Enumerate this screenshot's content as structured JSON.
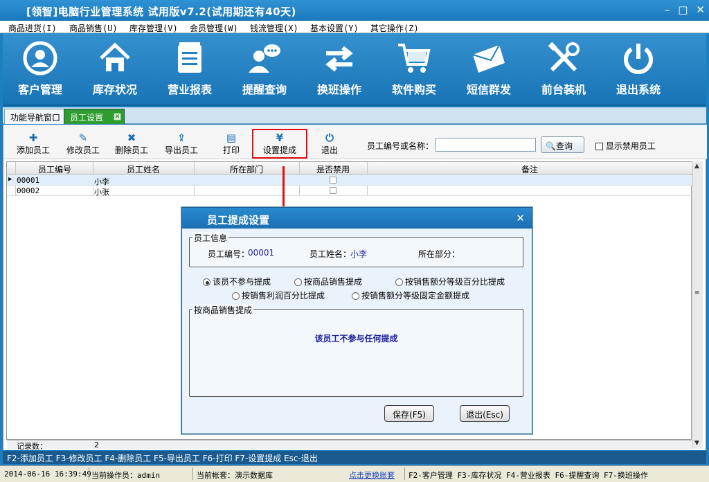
{
  "window": {
    "title": "[领智]电脑行业管理系统 试用版v7.2(试用期还有40天)",
    "minimize": "–",
    "maximize": "□",
    "close": "✕"
  },
  "menu": [
    "商品进货(I)",
    "商品销售(U)",
    "库存管理(V)",
    "会员管理(W)",
    "钱流管理(X)",
    "基本设置(Y)",
    "其它操作(Z)"
  ],
  "nav": [
    {
      "label": "客户管理",
      "icon": "user-icon"
    },
    {
      "label": "库存状况",
      "icon": "house-icon"
    },
    {
      "label": "营业报表",
      "icon": "clipboard-icon"
    },
    {
      "label": "提醒查询",
      "icon": "chat-user-icon"
    },
    {
      "label": "换班操作",
      "icon": "swap-arrows-icon"
    },
    {
      "label": "软件购买",
      "icon": "cart-icon"
    },
    {
      "label": "短信群发",
      "icon": "envelope-icon"
    },
    {
      "label": "前台装机",
      "icon": "tools-icon"
    },
    {
      "label": "退出系统",
      "icon": "power-icon"
    }
  ],
  "tabs": {
    "nav_window": "功能导航窗口",
    "staff": "员工设置",
    "close": "✕"
  },
  "toolbar": {
    "add": "添加员工",
    "edit": "修改员工",
    "delete": "删除员工",
    "export": "导出员工",
    "print": "打印",
    "commission": "设置提成",
    "exit": "退出",
    "search_label": "员工编号或名称：",
    "search_value": "",
    "query": "查询",
    "show_disabled": "显示禁用员工"
  },
  "grid": {
    "columns": [
      "员工编号",
      "员工姓名",
      "所在部门",
      "是否禁用",
      "备注"
    ],
    "rows": [
      {
        "id": "00001",
        "name": "小李",
        "dept": "",
        "disabled": false,
        "note": ""
      },
      {
        "id": "00002",
        "name": "小张",
        "dept": "",
        "disabled": false,
        "note": ""
      }
    ],
    "footer_label": "记录数：",
    "footer_count": "2"
  },
  "dialog": {
    "title": "员工提成设置",
    "info_legend": "员工信息",
    "id_label": "员工编号：",
    "id_value": "00001",
    "name_label": "员工姓名：",
    "name_value": "小李",
    "dept_label": "所在部分：",
    "dept_value": "",
    "options": [
      "该员不参与提成",
      "按商品销售提成",
      "按销售额分等级百分比提成",
      "按销售利润百分比提成",
      "按销售额分等级固定金额提成"
    ],
    "selected_option": 0,
    "section_legend": "按商品销售提成",
    "message": "该员工不参与任何提成",
    "save": "保存(F5)",
    "exit": "退出(Esc)"
  },
  "hint": "F2-添加员工 F3-修改员工 F4-删除员工 F5-导出员工 F6-打印 F7-设置提成 Esc-退出",
  "status": {
    "datetime": "2014-06-16 16:39:49",
    "operator": "当前操作员：admin",
    "account": "当前帐套：演示数据库",
    "switch_link": "点击更换账套",
    "shortcuts": "F2-客户管理 F3-库存状况 F4-营业报表 F6-提醒查询 F7-换班操作"
  },
  "colors": {
    "title_bg": "#1b78bb",
    "tab_active": "#2e9c2e",
    "highlight": "#e01010"
  }
}
